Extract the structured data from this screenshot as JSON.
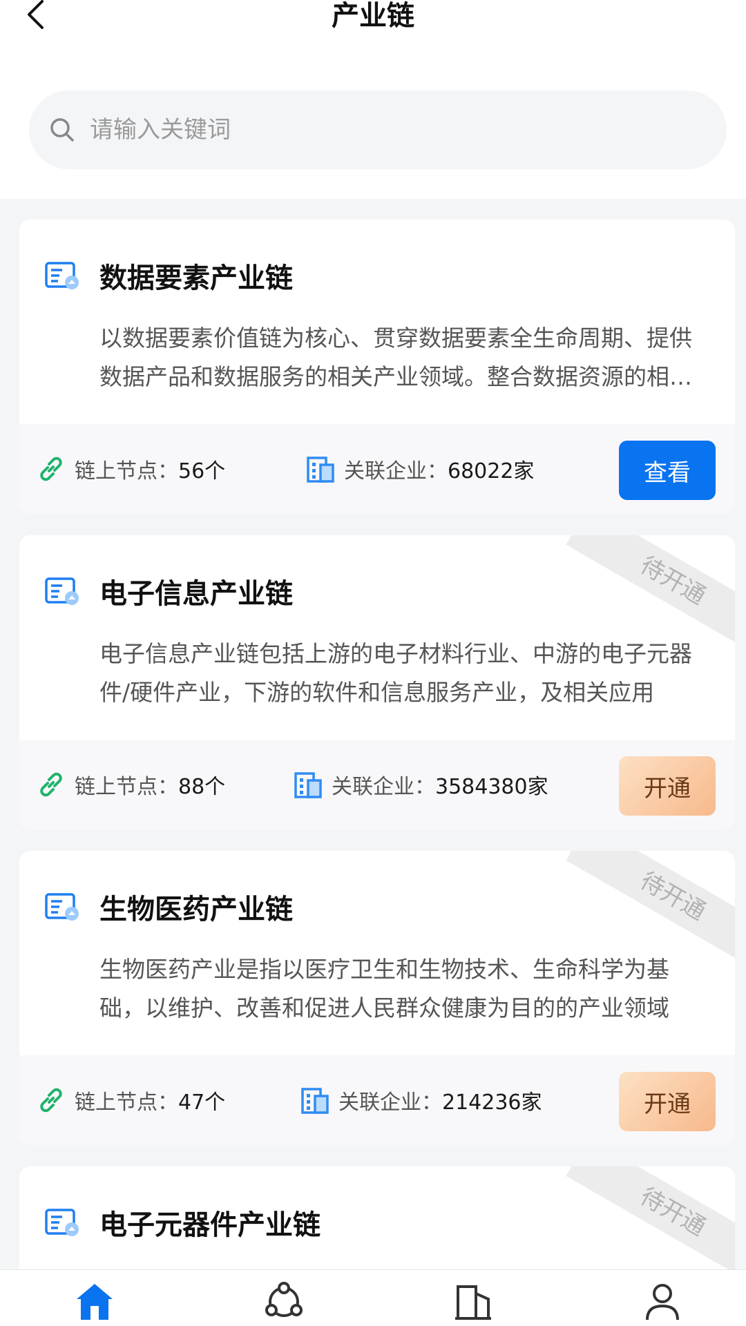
{
  "header": {
    "title": "产业链",
    "back_icon": "chevron-left-icon"
  },
  "search": {
    "placeholder": "请输入关键词",
    "value": ""
  },
  "cards": [
    {
      "title": "数据要素产业链",
      "description": "以数据要素价值链为核心、贯穿数据要素全生命周期、提供数据产品和数据服务的相关产业领域。整合数据资源的相关产业",
      "nodes_label": "链上节点：",
      "nodes_value": "56个",
      "companies_label": "关联企业：",
      "companies_value": "68022家",
      "action_label": "查看",
      "status_ribbon": ""
    },
    {
      "title": "电子信息产业链",
      "description": "电子信息产业链包括上游的电子材料行业、中游的电子元器件/硬件产业，下游的软件和信息服务产业，及相关应用",
      "nodes_label": "链上节点：",
      "nodes_value": "88个",
      "companies_label": "关联企业：",
      "companies_value": "3584380家",
      "action_label": "开通",
      "status_ribbon": "待开通"
    },
    {
      "title": "生物医药产业链",
      "description": "生物医药产业是指以医疗卫生和生物技术、生命科学为基础，以维护、改善和促进人民群众健康为目的的产业领域",
      "nodes_label": "链上节点：",
      "nodes_value": "47个",
      "companies_label": "关联企业：",
      "companies_value": "214236家",
      "action_label": "开通",
      "status_ribbon": "待开通"
    },
    {
      "title": "电子元器件产业链",
      "status_ribbon": "待开通"
    }
  ],
  "tabbar": [
    {
      "icon": "home-icon",
      "active": true
    },
    {
      "icon": "network-icon",
      "active": false
    },
    {
      "icon": "building-icon",
      "active": false
    },
    {
      "icon": "user-icon",
      "active": false
    }
  ],
  "colors": {
    "primary": "#0a73f0",
    "open_button": "#f7b98b",
    "link_icon": "#1fb36b",
    "building_icon": "#2f8cf2"
  }
}
